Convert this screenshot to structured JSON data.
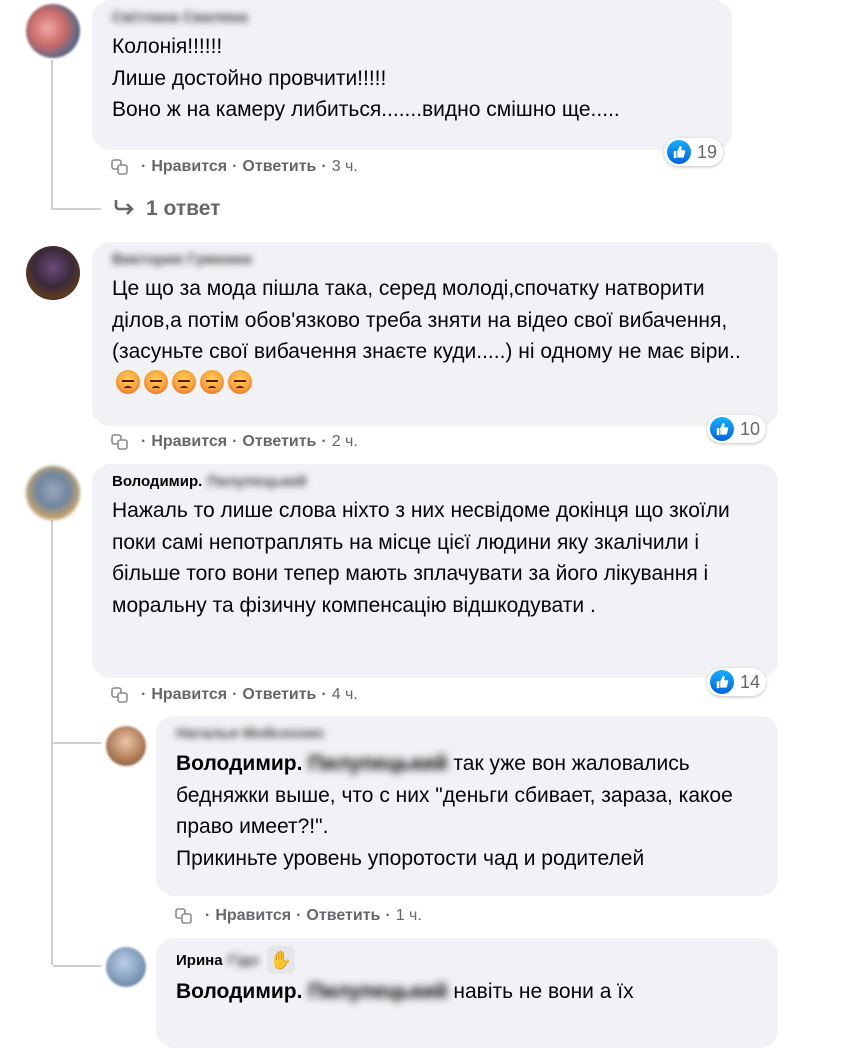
{
  "comments": [
    {
      "author_visible": "Світлана",
      "author_hidden": "Світлана Свиляна",
      "lines": "Колонія!!!!!!\nЛише достойно провчити!!!!!\nВоно ж на камеру либиться.......видно смішно ще.....",
      "actions": {
        "like": "Нравится",
        "reply": "Ответить",
        "time": "3 ч."
      },
      "reactions": "19",
      "replies_link": "1 ответ"
    },
    {
      "author_hidden": "Виктория Гуменюк",
      "lines": "Це що за мода пішла така, серед молоді,спочатку натворити ділов,а потім обов'язково треба зняти на відео свої вибачення,(засуньте свої вибачення знаєте куди.....) ні одному не має віри..",
      "emoji": [
        "angry-face-emoji",
        "angry-face-emoji",
        "angry-face-emoji",
        "angry-face-emoji",
        "angry-face-emoji"
      ],
      "actions": {
        "like": "Нравится",
        "reply": "Ответить",
        "time": "2 ч."
      },
      "reactions": "10"
    },
    {
      "author_visible": "Володимир.",
      "author_hidden": "Пилупецький",
      "lines": "Нажаль то лише слова ніхто з них несвідоме докінця що зкоїли поки самі непотраплять на місце цієї людини яку зкалічили і більше того вони тепер мають зплачувати за його лікування і моральну та фізичну компенсацію відшкодувати .",
      "actions": {
        "like": "Нравится",
        "reply": "Ответить",
        "time": "4 ч."
      },
      "reactions": "14"
    },
    {
      "author_hidden": "Наталья Мойсеєнко",
      "mention_visible": "Володимир.",
      "mention_hidden": "Пилупецький",
      "lines": " так уже вон жаловались бедняжки выше, что с них \"деньги сбивает, зараза, какое право имеет?!\".\nПрикиньте уровень упоротости чад и родителей",
      "actions": {
        "like": "Нравится",
        "reply": "Ответить",
        "time": "1 ч."
      }
    },
    {
      "author_visible": "Ирина",
      "author_hidden": "Гідо",
      "mention_visible": "Володимир.",
      "mention_hidden": "Пилупецький",
      "lines": " навіть не вони а їх"
    }
  ],
  "icons": {
    "translate": "translate-icon",
    "like": "thumbs-up-icon",
    "reply_arrow": "reply-arrow-icon",
    "badge": "raised-hand-icon"
  },
  "colors": {
    "bubble": "#f0f2f5",
    "meta": "#65676b",
    "like_blue": "#1877f2"
  }
}
